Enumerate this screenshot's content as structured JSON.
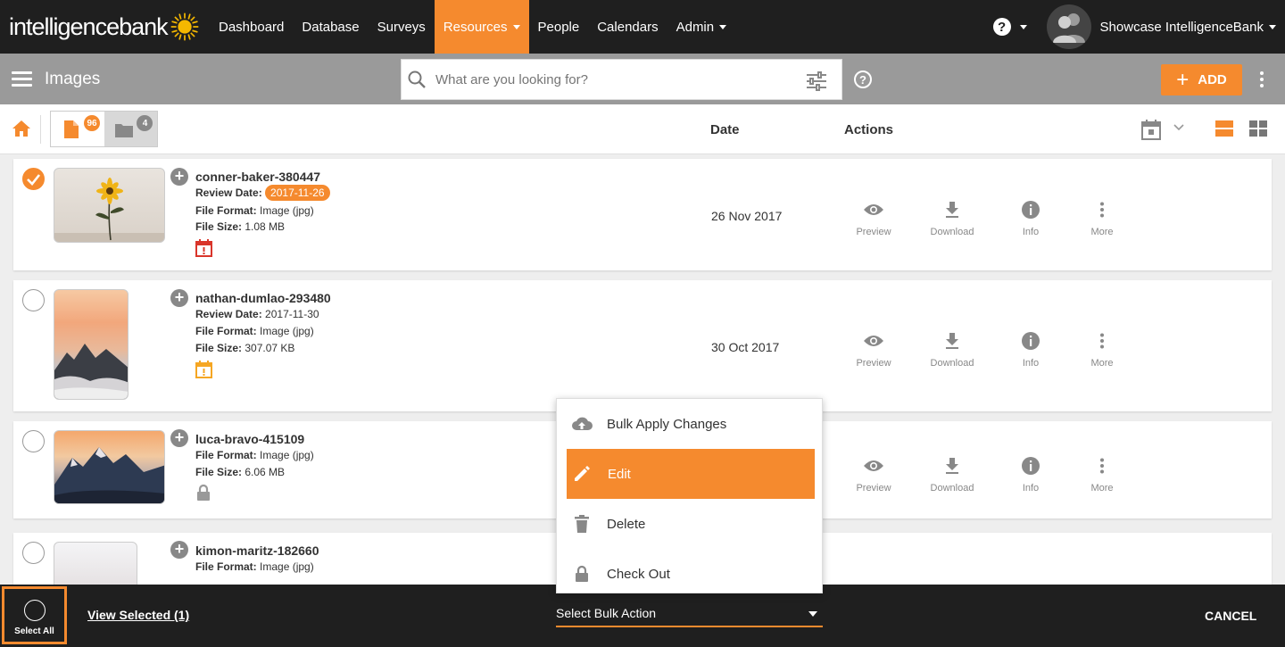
{
  "colors": {
    "accent": "#f58a2e",
    "nav_bg": "#1f1f1f",
    "subheader_bg": "#9a9a9a",
    "overdue": "#d9352b"
  },
  "brand": {
    "logo_text": "intelligencebank"
  },
  "nav": {
    "items": [
      {
        "label": "Dashboard",
        "active": false,
        "has_caret": false
      },
      {
        "label": "Database",
        "active": false,
        "has_caret": false
      },
      {
        "label": "Surveys",
        "active": false,
        "has_caret": false
      },
      {
        "label": "Resources",
        "active": true,
        "has_caret": true
      },
      {
        "label": "People",
        "active": false,
        "has_caret": false
      },
      {
        "label": "Calendars",
        "active": false,
        "has_caret": false
      },
      {
        "label": "Admin",
        "active": false,
        "has_caret": true
      }
    ],
    "help_label": "?",
    "user_name": "Showcase IntelligenceBank"
  },
  "subheader": {
    "title": "Images",
    "search_placeholder": "What are you looking for?",
    "help_label": "?",
    "add_label": "ADD",
    "add_plus": "+"
  },
  "toolbar": {
    "files_count": "96",
    "folders_count": "4",
    "date_header": "Date",
    "actions_header": "Actions"
  },
  "actions": {
    "preview": "Preview",
    "download": "Download",
    "info": "Info",
    "more": "More"
  },
  "assets": [
    {
      "name": "conner-baker-380447",
      "review_label": "Review Date:",
      "review_date": "2017-11-26",
      "format_label": "File Format:",
      "format": "Image (jpg)",
      "size_label": "File Size:",
      "size": "1.08 MB",
      "date": "26 Nov 2017",
      "checked": true,
      "status_icon": "calendar-alert-icon"
    },
    {
      "name": "nathan-dumlao-293480",
      "review_label": "Review Date:",
      "review_date": "2017-11-30",
      "format_label": "File Format:",
      "format": "Image (jpg)",
      "size_label": "File Size:",
      "size": "307.07 KB",
      "date": "30 Oct 2017",
      "checked": false,
      "status_icon": "calendar-warning-icon"
    },
    {
      "name": "luca-bravo-415109",
      "format_label": "File Format:",
      "format": "Image (jpg)",
      "size_label": "File Size:",
      "size": "6.06 MB",
      "checked": false,
      "status_icon": "lock-icon"
    },
    {
      "name": "kimon-maritz-182660",
      "format_label": "File Format:",
      "format": "Image (jpg)",
      "checked": false
    }
  ],
  "bulk_menu": {
    "items": [
      {
        "label": "Bulk Apply Changes",
        "icon": "cloud-upload-icon"
      },
      {
        "label": "Edit",
        "icon": "pencil-icon",
        "active": true
      },
      {
        "label": "Delete",
        "icon": "trash-icon"
      },
      {
        "label": "Check Out",
        "icon": "lock-icon"
      }
    ]
  },
  "bottombar": {
    "select_all": "Select All",
    "view_selected": "View Selected (1)",
    "bulk_action": "Select Bulk Action",
    "cancel": "CANCEL"
  }
}
